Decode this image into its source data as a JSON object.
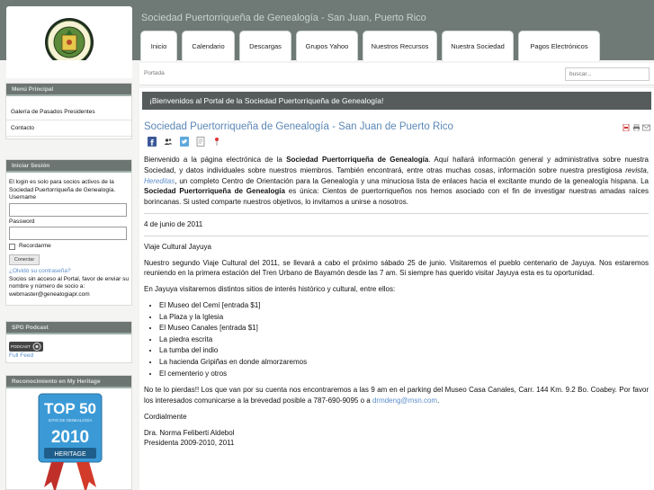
{
  "header": {
    "site_title": "Sociedad Puertorriqueña de Genealogía - San Juan, Puerto Rico",
    "logo_icon": "society-seal-logo"
  },
  "nav": {
    "tabs": [
      {
        "label": "Inicio"
      },
      {
        "label": "Calendario"
      },
      {
        "label": "Descargas"
      },
      {
        "label": "Grupos Yahoo"
      },
      {
        "label": "Nuestros Recursos"
      },
      {
        "label": "Nuestra Sociedad"
      },
      {
        "label": "Pagos Electrónicos"
      }
    ]
  },
  "topbar": {
    "breadcrumb": "Portada",
    "search_placeholder": "buscar..."
  },
  "sidebar": {
    "menu": {
      "title": "Menú Principal",
      "items": [
        {
          "label": "Galería de Pasados Presidentes"
        },
        {
          "label": "Contacto"
        }
      ]
    },
    "login": {
      "title": "Iniciar Sesión",
      "intro": "El login es solo para socios activos de la Sociedad Puertorriqueña de Genealogía.",
      "username_label": "Username",
      "password_label": "Password",
      "remember_label": "Recordarme",
      "submit_label": "Conectar",
      "forgot_label": "¿Olvidó su contraseña?",
      "note": "Socios sin acceso al Portal, favor de enviar su nombre y número de socio a: webmaster@genealogiapr.com"
    },
    "podcast": {
      "title": "SPG Podcast",
      "badge_label": "PODCAST",
      "feed_label": "Full Feed"
    },
    "heritage": {
      "title": "Reconocimiento en My Heritage",
      "badge_top": "TOP 50",
      "badge_sub": "SITIO DE GENEALOGÍA",
      "badge_year": "2010",
      "badge_brand": "HERITAGE"
    }
  },
  "main": {
    "welcome": "¡Bienvenidos al Portal de la Sociedad Puertorriqueña de Genealogía!",
    "article_title": "Sociedad Puertorriqueña de Genealogía - San Juan de Puerto Rico",
    "intro_1": "Bienvenido a la página electrónica de la ",
    "intro_bold_1": "Sociedad Puertorriqueña de Genealogía",
    "intro_2": ". Aquí hallará información general y administrativa sobre nuestra Sociedad, y datos individuales sobre nuestros miembros. También encontrará, entre otras muchas cosas, información sobre nuestra prestigiosa ",
    "intro_revista": "revista",
    "intro_comma": ", ",
    "intro_hereditas": "Hereditas",
    "intro_3": ", un completo Centro de Orientación para la Genealogía y una minuciosa lista de enlaces hacia el excitante mundo de la genealogía hispana. La ",
    "intro_bold_2": "Sociedad Puertorriqueña de Genealogía",
    "intro_4": " es única: Cientos de puertorriqueños nos hemos asociado con el fin de investigar nuestras amadas raíces borincanas. Si usted comparte nuestros objetivos, lo invitamos a unirse a nosotros.",
    "date": "4 de junio de 2011",
    "event_title": "Viaje Cultural Jayuya",
    "paragraph_1": "Nuestro segundo Viaje Cultural del 2011, se llevará a cabo el próximo sábado 25 de junio. Visitaremos el pueblo centenario de Jayuya. Nos estaremos reuniendo en la primera estación del Tren Urbano de Bayamón desde las 7 am. Si siempre has querido visitar Jayuya esta es tu oportunidad.",
    "paragraph_2": "En Jayuya visitaremos distintos sitios de interés histórico y cultural, entre ellos:",
    "sites": [
      "El Museo del Cemí [entrada $1]",
      "La Plaza y la Iglesia",
      "El Museo Canales [entrada $1]",
      "La piedra escrita",
      "La tumba del indio",
      "La hacienda Gripiñas en donde almorzaremos",
      "El cementerio y otros"
    ],
    "paragraph_3a": "No te lo pierdas!! Los que van por su cuenta nos encontraremos a las 9 am en el parking del Museo Casa Canales, Carr. 144 Km. 9.2 Bo. Coabey. Por favor los interesados comunicarse a la brevedad posible a 787-690-9095 o a ",
    "email": "drmdeng@msn.com",
    "paragraph_3b": ".",
    "closing": "Cordialmente",
    "signature": "Dra. Norma Feliberti Aldebol",
    "signature_title": "Presidenta 2009-2010, 2011"
  },
  "colors": {
    "header_bg": "#6f7a77",
    "welcome_bar": "#565c5b",
    "title_blue": "#5b87b5",
    "link_blue": "#5b8dc9"
  }
}
